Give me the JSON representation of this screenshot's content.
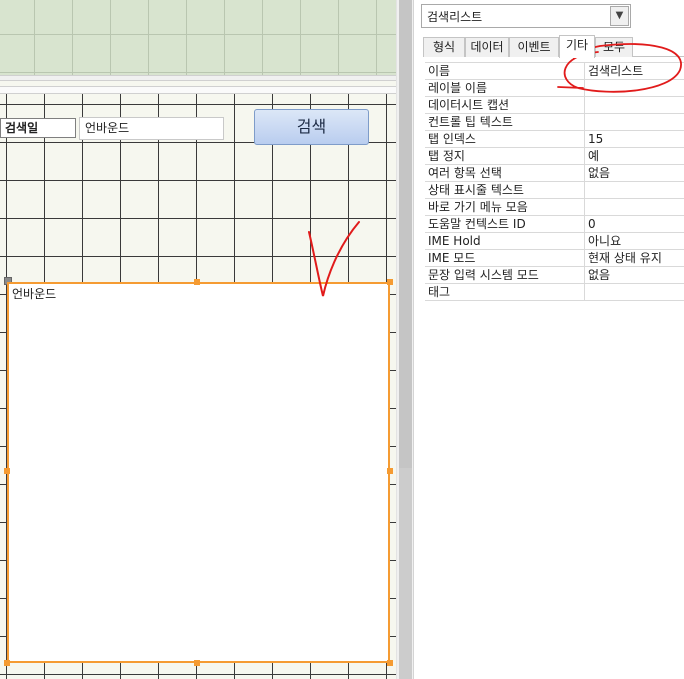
{
  "form": {
    "search_label": "검색일",
    "search_textbox_value": "언바운드",
    "search_button": "검색",
    "listbox_value": "언바운드"
  },
  "property_sheet": {
    "selected_object": "검색리스트",
    "tabs": [
      {
        "label": "형식"
      },
      {
        "label": "데이터"
      },
      {
        "label": "이벤트"
      },
      {
        "label": "기타"
      },
      {
        "label": "모두"
      }
    ],
    "active_tab": "기타",
    "rows": [
      {
        "name": "이름",
        "value": "검색리스트"
      },
      {
        "name": "레이블 이름",
        "value": ""
      },
      {
        "name": "데이터시트 캡션",
        "value": ""
      },
      {
        "name": "컨트롤 팁 텍스트",
        "value": ""
      },
      {
        "name": "탭 인덱스",
        "value": "15"
      },
      {
        "name": "탭 정지",
        "value": "예"
      },
      {
        "name": "여러 항목 선택",
        "value": "없음"
      },
      {
        "name": "상태 표시줄 텍스트",
        "value": ""
      },
      {
        "name": "바로 가기 메뉴 모음",
        "value": ""
      },
      {
        "name": "도움말 컨텍스트 ID",
        "value": "0"
      },
      {
        "name": "IME Hold",
        "value": "아니요"
      },
      {
        "name": "IME 모드",
        "value": "현재 상태 유지"
      },
      {
        "name": "문장 입력 시스템 모드",
        "value": "없음"
      },
      {
        "name": "태그",
        "value": ""
      }
    ]
  },
  "colors": {
    "selection_border": "#f59b32",
    "annotation_ink": "#e11b1b",
    "header_section": "#d8e4cf",
    "button_gradient_top": "#dce7f7",
    "button_gradient_bottom": "#b9cdef"
  }
}
